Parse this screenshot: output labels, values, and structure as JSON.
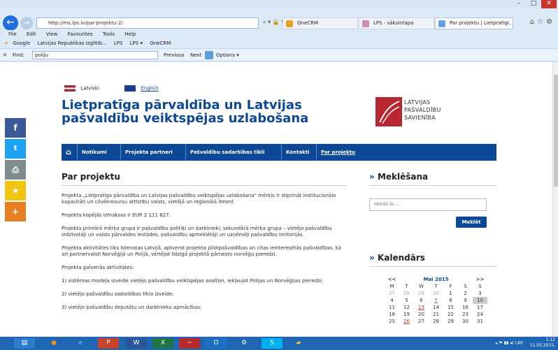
{
  "browser": {
    "url": "http://ms.lps.lv/par-projektu-2/",
    "url_icons": "⌕ ▾ 🔒 ↻",
    "tabs": [
      {
        "label": "OneCRM",
        "color": "#e8a21c"
      },
      {
        "label": "LPS - sākumlapa",
        "color": "#c98fb8"
      },
      {
        "label": "Par projektu | Lietpratīg...",
        "color": "#5ea4e6"
      }
    ],
    "menu": [
      "File",
      "Edit",
      "View",
      "Favourites",
      "Tools",
      "Help"
    ],
    "favourites": [
      "Google",
      "Latvijas Republikas Izglītīb...",
      "LPS",
      "LPS ▾",
      "OneCRM"
    ],
    "find_label": "Find:",
    "find_value": "poliju",
    "find_previous": "Previous",
    "find_next": "Next",
    "find_options": "Options ▾",
    "find_close": "✕",
    "window_controls": [
      "–",
      "□",
      "✕"
    ]
  },
  "share": [
    {
      "icon": "facebook-icon",
      "glyph": "f",
      "color": "#3b5998"
    },
    {
      "icon": "twitter-icon",
      "glyph": "🐦",
      "color": "#1da1f2"
    },
    {
      "icon": "print-icon",
      "glyph": "⎙",
      "color": "#7f8c8d"
    },
    {
      "icon": "favorite-icon",
      "glyph": "★",
      "color": "#f1c40f"
    },
    {
      "icon": "more-icon",
      "glyph": "+",
      "color": "#e67e22"
    }
  ],
  "site": {
    "lang_lv": "Latviski",
    "lang_en": "English",
    "title": "Lietpratīga pārvaldība un Latvijas pašvaldību veiktspējas uzlabošana",
    "logo_lines": [
      "LATVIJAS",
      "PAŠVALDĪBU",
      "SAVIENĪBA"
    ],
    "nav": [
      "Notikumi",
      "Projekta partneri",
      "Pašvaldību sadarbības tīkli",
      "Kontakti",
      "Par projektu"
    ],
    "home_icon": "⌂"
  },
  "main": {
    "title": "Par projektu",
    "paragraphs": [
      "Projekta „Lietpratīga pārvaldība un Latvijas pašvaldību veiktspējas uzlabošana” mērķis ir stiprināt institucionālo kapacitāti un cilvēkresursu attīstību valsts, vietējā un reģionālā līmenī.",
      "Projekta kopējās izmaksas ir EUR 2 111 827.",
      "Projekta primārā mērķa grupa ir pašvaldību politiķi un darbinieki; sekundārā mērķa grupa – vietējo pašvaldību iedzīvotāji un valsts pārvaldes iestādes, pašvaldību apmeklētāji un uzņēmēji pašvaldību teritorijās.",
      "Projekta aktivitātes tiks īstenotas Latvijā, aptverot projekta pilotpašvaldības un citas ieinteresētās pašvaldības, kā arī partnervalstī Norvēģijā un Polijā, vērtējot līdzīgā projektā pārnesto norvēģu pieredzi.",
      "Projekta galvenās aktivitātes:",
      "1)     sistēmas modeļa izveide vietējo pašvaldību veiktspējas analīzei, iekļaujot Polijas un Norvēģijas pieredzi;",
      "2)     vietējo pašvaldību sadarbības tīkla izveide;",
      "3)     vietējo pašvaldību deputātu un darbinieku apmācības;"
    ]
  },
  "sidebar": {
    "search_title": "Meklēšana",
    "search_placeholder": "Meklēt šo ...",
    "search_button": "Meklēt",
    "calendar_title": "Kalendārs",
    "calendar": {
      "prev": "<<",
      "month": "Mai 2015",
      "next": ">>",
      "weekdays": [
        "M",
        "T",
        "W",
        "T",
        "F",
        "S",
        "S"
      ],
      "weeks": [
        [
          "27",
          "28",
          "29",
          "30",
          "1",
          "2",
          "3"
        ],
        [
          "4",
          "5",
          "6",
          "7",
          "8",
          "9",
          "10"
        ],
        [
          "11",
          "12",
          "13",
          "14",
          "15",
          "16",
          "17"
        ],
        [
          "18",
          "19",
          "20",
          "21",
          "22",
          "23",
          "24"
        ],
        [
          "25",
          "26",
          "27",
          "28",
          "29",
          "30",
          "31"
        ]
      ]
    },
    "section_marker": "»"
  },
  "taskbar": {
    "lang": "LAV",
    "time": "1:12",
    "date": "11.05.2015."
  }
}
